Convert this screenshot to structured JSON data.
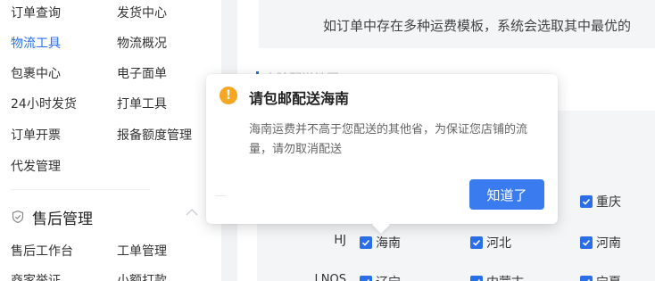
{
  "sidebar": {
    "items": [
      {
        "label": "订单查询"
      },
      {
        "label": "发货中心"
      },
      {
        "label": "物流工具",
        "active": true
      },
      {
        "label": "物流概况"
      },
      {
        "label": "包裹中心"
      },
      {
        "label": "电子面单"
      },
      {
        "label": "24小时发货"
      },
      {
        "label": "打单工具"
      },
      {
        "label": "订单开票"
      },
      {
        "label": "报备额度管理"
      },
      {
        "label": "代发管理"
      }
    ],
    "section": {
      "title": "售后管理",
      "icon": "shield-check-icon"
    },
    "after_items": [
      {
        "label": "售后工作台"
      },
      {
        "label": "工单管理"
      },
      {
        "label": "商家举证"
      },
      {
        "label": "小额打款"
      }
    ]
  },
  "main": {
    "notice": "如订单中存在多种运费模板，系统会选取其中最优的",
    "section_ghost": "去除配送地区",
    "rows": [
      {
        "label": "HJ",
        "checks": [
          {
            "label": "海南",
            "checked": true
          },
          {
            "label": "河北",
            "checked": true
          },
          {
            "label": "河南",
            "checked": true
          }
        ]
      },
      {
        "label": "LNOS",
        "checks": [
          {
            "label": "辽宁",
            "checked": true
          },
          {
            "label": "内蒙古",
            "checked": true
          },
          {
            "label": "宁夏",
            "checked": true
          }
        ]
      }
    ],
    "top_right_check": {
      "label": "重庆",
      "checked": true
    }
  },
  "popover": {
    "icon": "warning-icon",
    "icon_glyph": "!",
    "title": "请包邮配送海南",
    "body": "海南运费并不高于您配送的其他省，为保证您店铺的流量，请勿取消配送",
    "confirm_label": "知道了"
  },
  "colors": {
    "accent": "#2b6fe8",
    "warning": "#f5a623",
    "button": "#3a7bf0"
  }
}
